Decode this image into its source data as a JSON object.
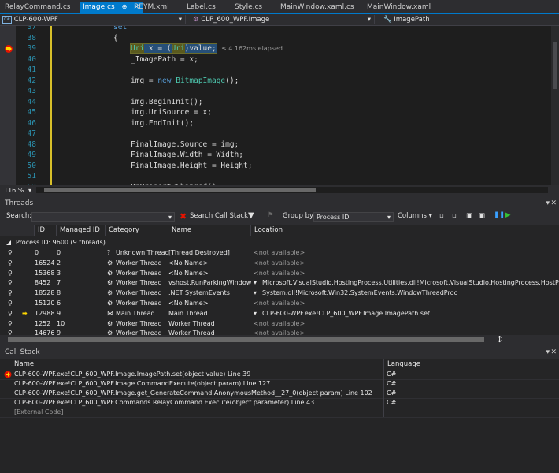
{
  "tabs": [
    {
      "label": "RelayCommand.cs"
    },
    {
      "label": "Image.cs",
      "pin": "⊕",
      "close": "✕"
    },
    {
      "label": "REYM.xml"
    },
    {
      "label": "Label.cs"
    },
    {
      "label": "Style.cs"
    },
    {
      "label": "MainWindow.xaml.cs"
    },
    {
      "label": "MainWindow.xaml"
    }
  ],
  "nav": {
    "project": "CLP-600-WPF",
    "class": "CLP_600_WPF.Image",
    "member": "ImagePath"
  },
  "editor": {
    "lines": [
      {
        "n": "37",
        "code": "set"
      },
      {
        "n": "38",
        "code": "{"
      },
      {
        "n": "39",
        "code": "Uri x = (Uri)value;"
      },
      {
        "n": "40",
        "code": "_ImagePath = x;"
      },
      {
        "n": "41",
        "code": ""
      },
      {
        "n": "42",
        "code": "img = new BitmapImage();"
      },
      {
        "n": "43",
        "code": ""
      },
      {
        "n": "44",
        "code": "img.BeginInit();"
      },
      {
        "n": "45",
        "code": "img.UriSource = x;"
      },
      {
        "n": "46",
        "code": "img.EndInit();"
      },
      {
        "n": "47",
        "code": ""
      },
      {
        "n": "48",
        "code": "FinalImage.Source = img;"
      },
      {
        "n": "49",
        "code": "FinalImage.Width = Width;"
      },
      {
        "n": "50",
        "code": "FinalImage.Height = Height;"
      },
      {
        "n": "51",
        "code": ""
      },
      {
        "n": "52",
        "code": "OnPropertyChanged();"
      }
    ],
    "elapsed": "≤ 4.162ms elapsed",
    "zoom": "116 %"
  },
  "threads": {
    "title": "Threads",
    "search_label": "Search:",
    "search_call_stack": "Search Call Stack",
    "group_by_label": "Group by:",
    "group_by_value": "Process ID",
    "columns_label": "Columns",
    "headers": [
      "ID",
      "Managed ID",
      "Category",
      "Name",
      "Location"
    ],
    "process_label": "Process ID: 9600  (9 threads)",
    "rows": [
      {
        "id": "0",
        "mid": "0",
        "cat": "Unknown Thread",
        "name": "[Thread Destroyed]",
        "loc": "<not available>",
        "muted": true
      },
      {
        "id": "16524",
        "mid": "2",
        "cat": "Worker Thread",
        "name": "<No Name>",
        "loc": "<not available>",
        "muted": true
      },
      {
        "id": "15368",
        "mid": "3",
        "cat": "Worker Thread",
        "name": "<No Name>",
        "loc": "<not available>",
        "muted": true
      },
      {
        "id": "8452",
        "mid": "7",
        "cat": "Worker Thread",
        "name": "vshost.RunParkingWindow",
        "loc": "Microsoft.VisualStudio.HostingProcess.Utilities.dll!Microsoft.VisualStudio.HostingProcess.HostProc.WaitF",
        "muted": false
      },
      {
        "id": "18528",
        "mid": "8",
        "cat": "Worker Thread",
        "name": ".NET SystemEvents",
        "loc": "System.dll!Microsoft.Win32.SystemEvents.WindowThreadProc",
        "muted": false
      },
      {
        "id": "15120",
        "mid": "6",
        "cat": "Worker Thread",
        "name": "<No Name>",
        "loc": "<not available>",
        "muted": true
      },
      {
        "id": "12988",
        "mid": "9",
        "cat": "Main Thread",
        "name": "Main Thread",
        "loc": "CLP-600-WPF.exe!CLP_600_WPF.Image.ImagePath.set",
        "muted": false,
        "current": true
      },
      {
        "id": "1252",
        "mid": "10",
        "cat": "Worker Thread",
        "name": "Worker Thread",
        "loc": "<not available>",
        "muted": true
      },
      {
        "id": "14676",
        "mid": "9",
        "cat": "Worker Thread",
        "name": "Worker Thread",
        "loc": "<not available>",
        "muted": true
      }
    ]
  },
  "callstack": {
    "title": "Call Stack",
    "headers": [
      "Name",
      "Language"
    ],
    "rows": [
      {
        "name": "CLP-600-WPF.exe!CLP_600_WPF.Image.ImagePath.set(object value) Line 39",
        "lang": "C#",
        "current": true
      },
      {
        "name": "CLP-600-WPF.exe!CLP_600_WPF.Image.CommandExecute(object param) Line 127",
        "lang": "C#"
      },
      {
        "name": "CLP-600-WPF.exe!CLP_600_WPF.Image.get_GenerateCommand.AnonymousMethod__27_0(object param) Line 102",
        "lang": "C#"
      },
      {
        "name": "CLP-600-WPF.exe!CLP_600_WPF.Commands.RelayCommand.Execute(object parameter) Line 43",
        "lang": "C#"
      },
      {
        "name": "[External Code]",
        "lang": "",
        "muted": true
      }
    ]
  },
  "colors": {
    "accent": "#007acc",
    "breakpoint": "#e51400",
    "current_line": "#264f78"
  }
}
